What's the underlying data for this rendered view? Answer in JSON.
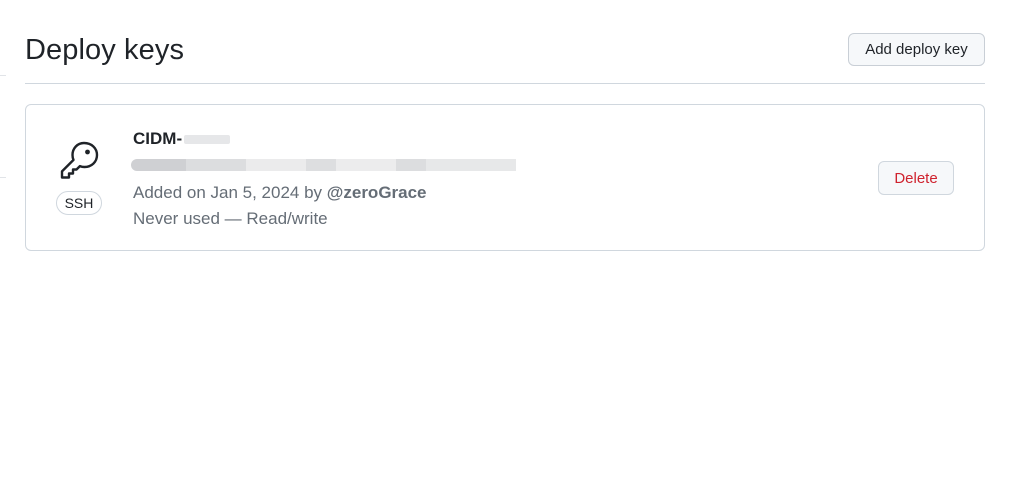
{
  "header": {
    "title": "Deploy keys",
    "add_button_label": "Add deploy key"
  },
  "deploy_keys": [
    {
      "name_visible": "CIDM-",
      "type_badge": "SSH",
      "added_prefix": "Added on Jan 5, 2024 by",
      "added_by": "@zeroGrace",
      "usage": "Never used — Read/write",
      "delete_label": "Delete",
      "icon": "key-icon"
    }
  ],
  "colors": {
    "delete_text": "#cf222e",
    "muted_text": "#656d76",
    "border": "#d0d7de",
    "button_bg": "#f6f8fa"
  }
}
